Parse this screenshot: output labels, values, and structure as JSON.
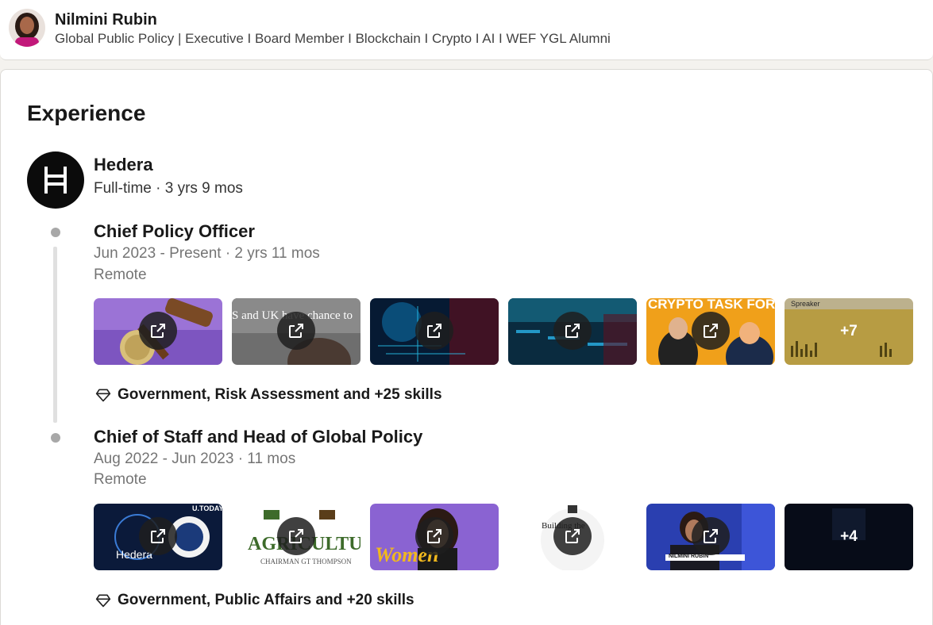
{
  "profile": {
    "name": "Nilmini Rubin",
    "headline": "Global Public Policy | Executive I Board Member I Blockchain I Crypto I AI I WEF YGL Alumni"
  },
  "section": {
    "title": "Experience"
  },
  "company": {
    "name": "Hedera",
    "meta": "Full-time · 3 yrs 9 mos",
    "logo_icon": "hedera-h-icon"
  },
  "roles": [
    {
      "title": "Chief Policy Officer",
      "dates": "Jun 2023 - Present · 2 yrs 11 mos",
      "location": "Remote",
      "media": [
        {
          "text": ""
        },
        {
          "text": "S and UK have chance to"
        },
        {
          "text": ""
        },
        {
          "text": ""
        },
        {
          "text": "CRYPTO TASK FORCE!"
        },
        {
          "text": "Spreaker"
        }
      ],
      "more_count": "+7",
      "skills": "Government, Risk Assessment and +25 skills"
    },
    {
      "title": "Chief of Staff and Head of Global Policy",
      "dates": "Aug 2022 - Jun 2023 · 11 mos",
      "location": "Remote",
      "media": [
        {
          "text": "Hedera",
          "brand": "U.TODAY"
        },
        {
          "text": "AGRICULTURE",
          "sub": "CHAIRMAN GT THOMPSON"
        },
        {
          "text": "Women"
        },
        {
          "text": "Building the"
        },
        {
          "text": "NILMINI RUBIN"
        },
        {
          "text": ""
        }
      ],
      "more_count": "+4",
      "skills": "Government, Public Affairs and +20 skills"
    }
  ],
  "colors": {
    "page_bg": "#f4f2ee",
    "card_bg": "#ffffff",
    "muted_text": "#737373",
    "timeline": "#a8a8a8"
  }
}
